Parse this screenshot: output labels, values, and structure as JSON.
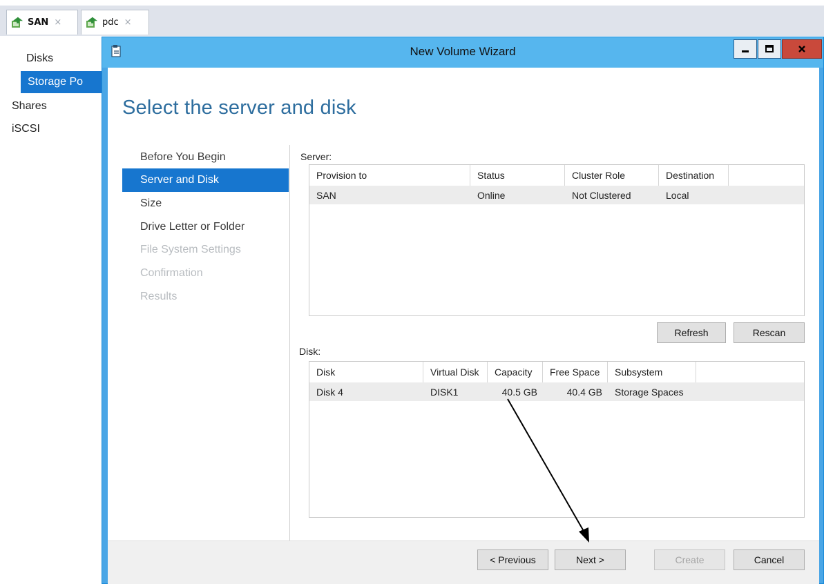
{
  "tabs": [
    {
      "label": "SAN",
      "close": "×"
    },
    {
      "label": "pdc",
      "close": "×"
    }
  ],
  "nav": {
    "items": [
      "Disks",
      "Storage Po",
      "Shares",
      "iSCSI"
    ]
  },
  "window": {
    "title": "New Volume Wizard"
  },
  "page": {
    "heading": "Select the server and disk",
    "steps": [
      "Before You Begin",
      "Server and Disk",
      "Size",
      "Drive Letter or Folder",
      "File System Settings",
      "Confirmation",
      "Results"
    ],
    "selected_step": "Server and Disk"
  },
  "server": {
    "label": "Server:",
    "columns": [
      "Provision to",
      "Status",
      "Cluster Role",
      "Destination"
    ],
    "rows": [
      [
        "SAN",
        "Online",
        "Not Clustered",
        "Local"
      ]
    ],
    "refresh_label": "Refresh",
    "rescan_label": "Rescan"
  },
  "disk": {
    "label": "Disk:",
    "columns": [
      "Disk",
      "Virtual Disk",
      "Capacity",
      "Free Space",
      "Subsystem"
    ],
    "rows": [
      [
        "Disk 4",
        "DISK1",
        "40.5 GB",
        "40.4 GB",
        "Storage Spaces"
      ]
    ]
  },
  "footer": {
    "previous_label": "< Previous",
    "next_label": "Next >",
    "create_label": "Create",
    "cancel_label": "Cancel"
  },
  "colors": {
    "accent": "#1776cf",
    "titlebar": "#56b6ee",
    "heading": "#2d6d9e"
  }
}
